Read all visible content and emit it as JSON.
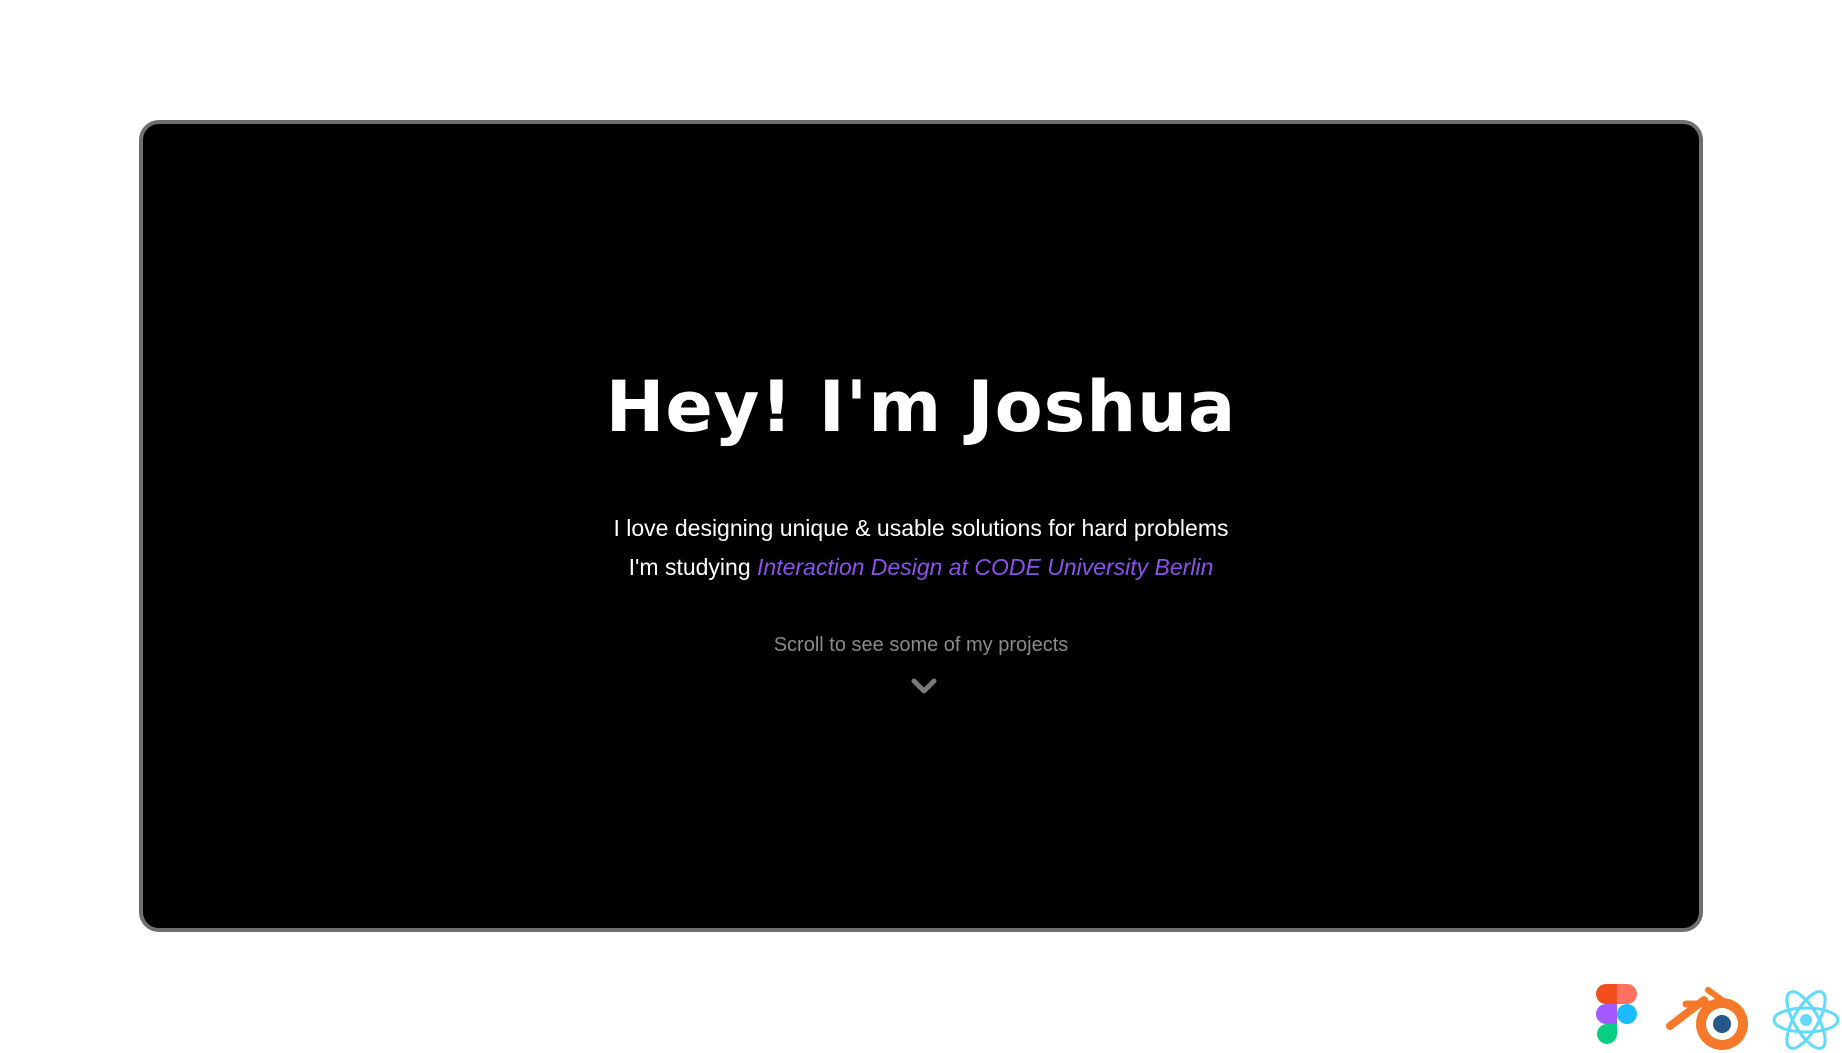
{
  "hero": {
    "title": "Hey! I'm Joshua",
    "line1": "I love designing unique & usable solutions for hard problems",
    "line2_prefix": "I'm studying ",
    "line2_link": "Interaction Design at CODE University Berlin",
    "scroll_hint": "Scroll to see some of my projects",
    "scroll_icon": "chevron-down-icon"
  },
  "tools": [
    {
      "name": "figma-icon"
    },
    {
      "name": "blender-icon"
    },
    {
      "name": "react-icon"
    }
  ],
  "colors": {
    "frame_bg": "#000000",
    "frame_border": "#6f6f6f",
    "accent": "#8b52e8",
    "muted": "#8a8a8a"
  }
}
